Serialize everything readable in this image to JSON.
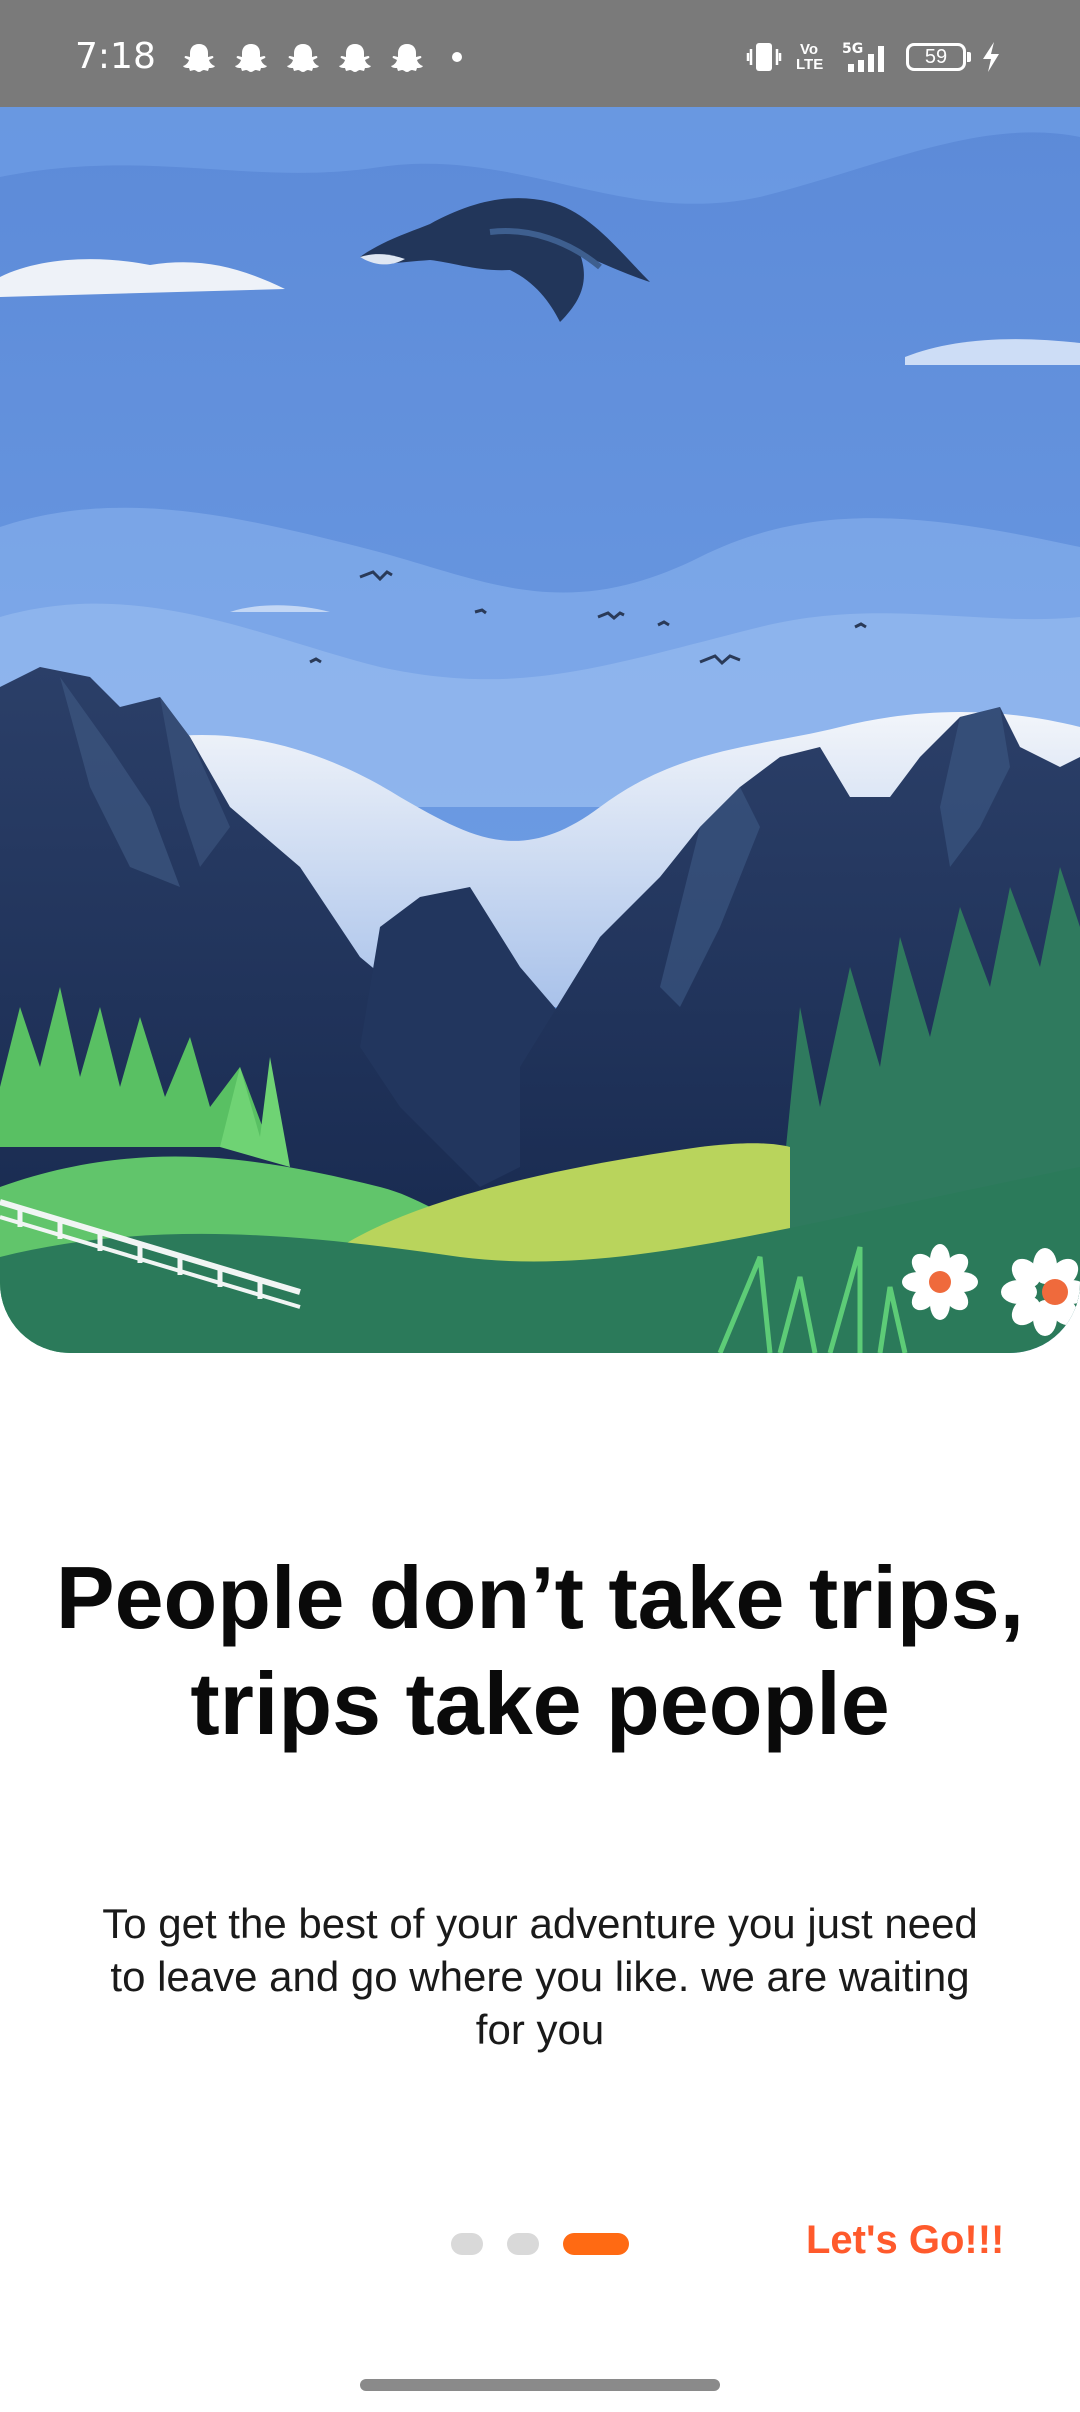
{
  "status_bar": {
    "time": "7:18",
    "notification_icons": [
      "snapchat-icon",
      "snapchat-icon",
      "snapchat-icon",
      "snapchat-icon",
      "snapchat-icon",
      "more-dot-icon"
    ],
    "volte_label": "Vo\nLTE",
    "network_label": "5G",
    "battery_level": "59",
    "icons": [
      "vibrate-icon",
      "volte-icon",
      "signal-5g-icon",
      "battery-icon",
      "charging-icon"
    ]
  },
  "onboarding": {
    "headline": "People don’t take trips,\ntrips take  people",
    "description": "To get the best of your adventure you just need to leave and go where you like. we are waiting for you",
    "page_count": 3,
    "active_page": 3,
    "cta_label": "Let's Go!!!"
  },
  "colors": {
    "accent": "#ff6a13",
    "cta_text": "#ff5a2c",
    "inactive_dot": "#d9d9d9",
    "status_bar_bg": "#7a7a7a"
  }
}
